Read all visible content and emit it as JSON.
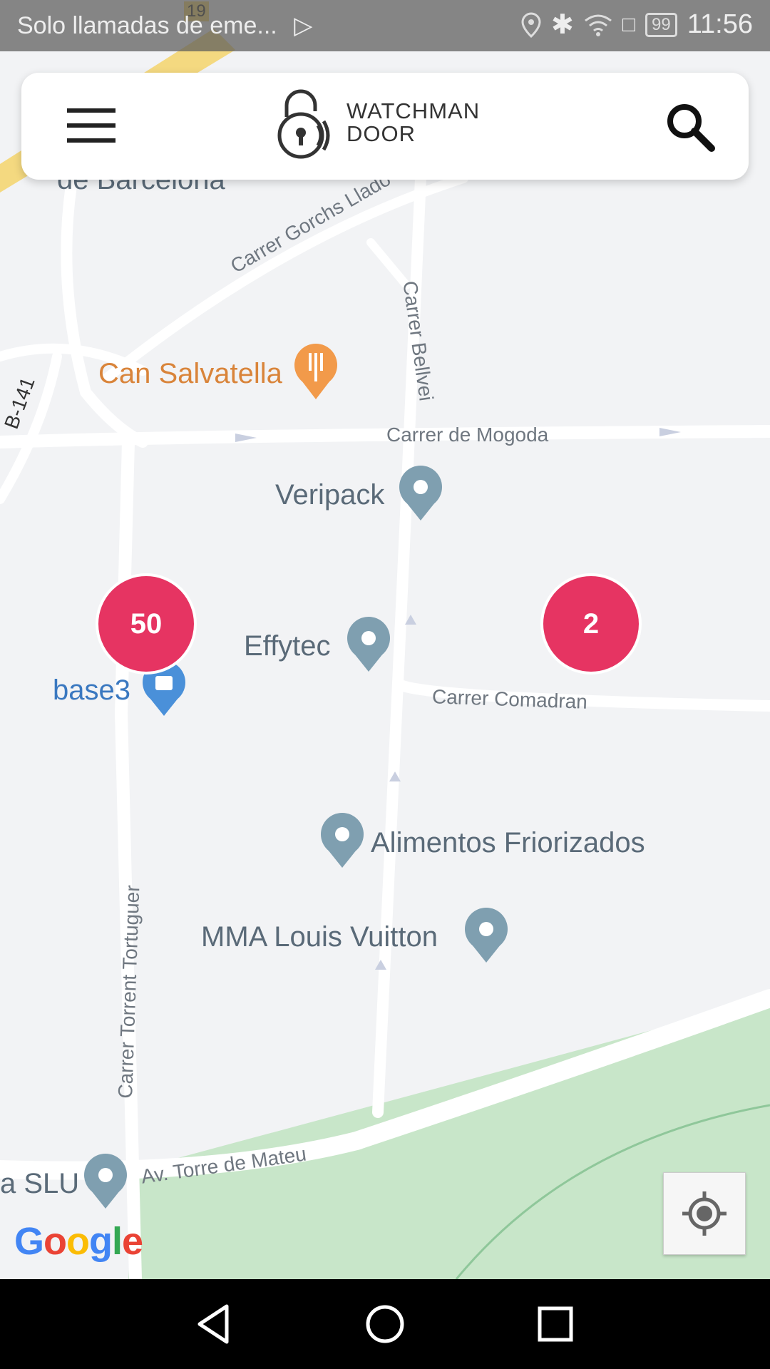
{
  "status_bar": {
    "carrier_text": "Solo llamadas de eme...",
    "battery": "99",
    "time": "11:56",
    "icons": [
      "play-store-icon",
      "location-icon",
      "bluetooth-icon",
      "wifi-icon",
      "alert-icon",
      "battery-icon"
    ]
  },
  "header": {
    "menu_icon": "hamburger-menu-icon",
    "brand_line1": "WATCHMAN",
    "brand_line2": "DOOR",
    "search_icon": "search-icon"
  },
  "map": {
    "places": [
      {
        "name": "de Barcelona"
      },
      {
        "name": "Can Salvatella"
      },
      {
        "name": "Veripack"
      },
      {
        "name": "Effytec"
      },
      {
        "name": "base3"
      },
      {
        "name": "Alimentos Friorizados"
      },
      {
        "name": "MMA Louis Vuitton"
      },
      {
        "name": "a SLU"
      }
    ],
    "streets": {
      "gorchs": "Carrer Gorchs Lladó",
      "bellvei": "Carrer Bellvei",
      "mogoda": "Carrer de Mogoda",
      "comadran": "Carrer Comadran",
      "tortuguer": "Carrer Torrent Tortuguer",
      "mateu": "Av. Torre de Mateu",
      "b141": "B-141",
      "route19": "19"
    },
    "clusters": [
      {
        "count": "50"
      },
      {
        "count": "2"
      }
    ],
    "attribution": "Google",
    "colors": {
      "cluster": "#e63462",
      "park": "#c8e6c9",
      "poi_pin": "#7f9fb0",
      "food_pin": "#f29a4a",
      "shop_pin": "#4a90d9"
    }
  },
  "controls": {
    "my_location_icon": "my-location-icon"
  },
  "nav_bar": {
    "back_icon": "back-icon",
    "home_icon": "home-icon",
    "recents_icon": "recents-icon"
  }
}
